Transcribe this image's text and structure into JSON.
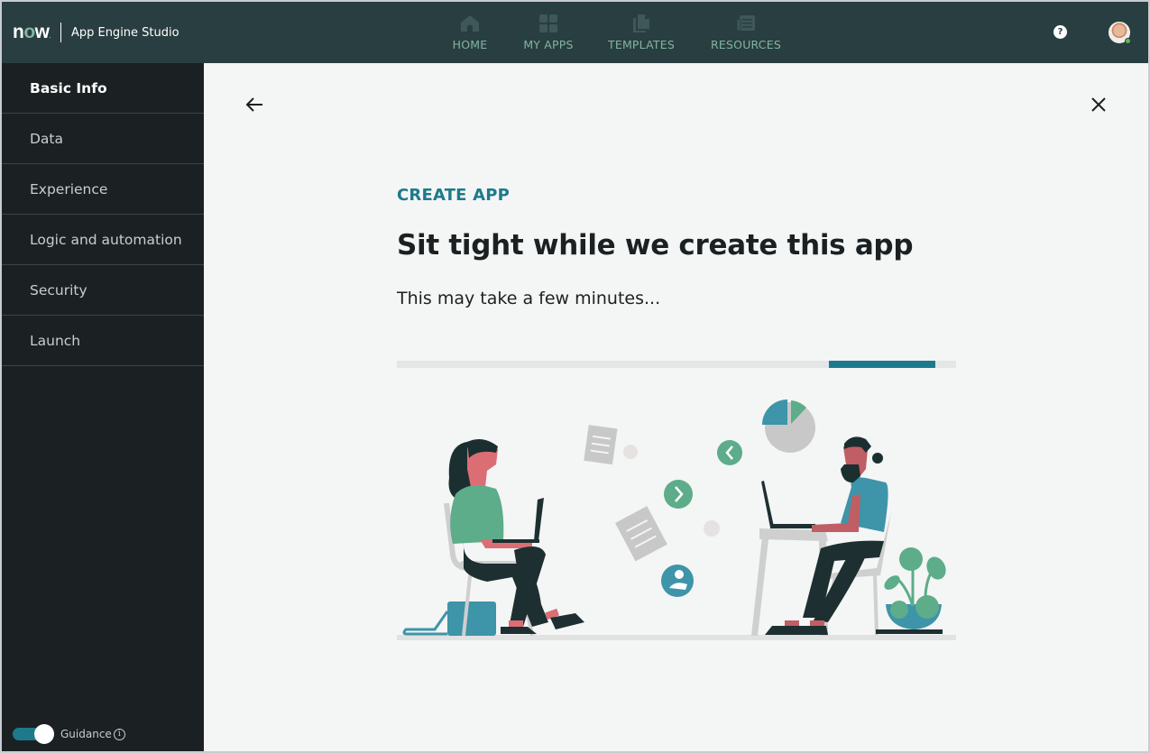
{
  "header": {
    "brand": "now",
    "app_title": "App Engine Studio",
    "nav": [
      {
        "label": "HOME",
        "icon": "home-icon"
      },
      {
        "label": "MY APPS",
        "icon": "grid-icon"
      },
      {
        "label": "TEMPLATES",
        "icon": "documents-icon"
      },
      {
        "label": "RESOURCES",
        "icon": "newspaper-icon"
      }
    ],
    "help_label": "?",
    "user_status_color": "#5cb85c"
  },
  "sidebar": {
    "items": [
      {
        "label": "Basic Info",
        "active": true
      },
      {
        "label": "Data",
        "active": false
      },
      {
        "label": "Experience",
        "active": false
      },
      {
        "label": "Logic and automation",
        "active": false
      },
      {
        "label": "Security",
        "active": false
      },
      {
        "label": "Launch",
        "active": false
      }
    ],
    "guidance": {
      "label": "Guidance",
      "enabled": true,
      "info_glyph": "i"
    }
  },
  "main": {
    "eyebrow": "CREATE APP",
    "title": "Sit tight while we create this app",
    "subtitle": "This may take a few minutes...",
    "progress": {
      "indeterminate": true,
      "segment_start": 0.773,
      "segment_end": 0.963
    }
  },
  "colors": {
    "header_bg": "#293e40",
    "sidebar_bg": "#1b2122",
    "accent": "#1d7a8c",
    "nav_text": "#81b5a1",
    "main_bg": "#f4f5f5"
  }
}
